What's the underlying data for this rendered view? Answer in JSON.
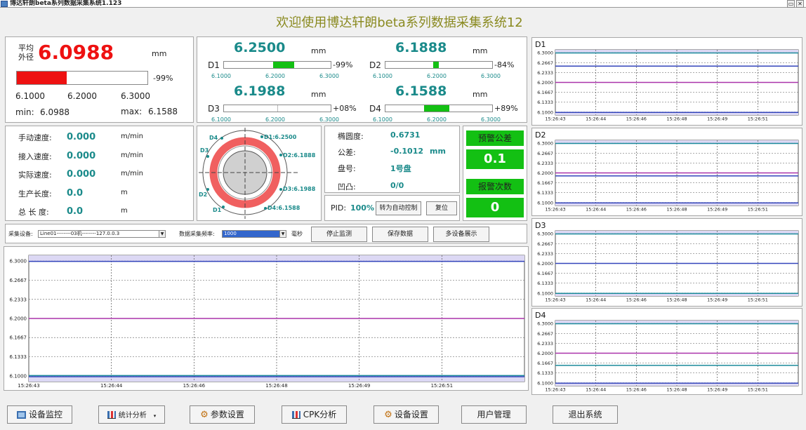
{
  "window": {
    "title": "博达轩朗beta系列数据采集系统1.123"
  },
  "app": {
    "title": "欢迎使用博达轩朗beta系列数据采集系统12"
  },
  "avg": {
    "label1": "平均",
    "label2": "外径",
    "value": "6.0988",
    "unit": "mm",
    "percent": "-99%",
    "fill": 0.38,
    "ticks": [
      "6.1000",
      "6.2000",
      "6.3000"
    ],
    "min_label": "min:",
    "min": "6.0988",
    "max_label": "max:",
    "max": "6.1588"
  },
  "sensors": [
    {
      "name": "D1",
      "value": "6.2500",
      "unit": "mm",
      "percent": "-99%",
      "ticks": [
        "6.1000",
        "6.2000",
        "6.3000"
      ],
      "fill_from": 0.46,
      "fill_to": 0.66
    },
    {
      "name": "D2",
      "value": "6.1888",
      "unit": "mm",
      "percent": "-84%",
      "ticks": [
        "6.1000",
        "6.2000",
        "6.3000"
      ],
      "fill_from": 0.45,
      "fill_to": 0.5
    },
    {
      "name": "D3",
      "value": "6.1988",
      "unit": "mm",
      "percent": "+08%",
      "ticks": [
        "6.1000",
        "6.2000",
        "6.3000"
      ],
      "fill_from": 0.5,
      "fill_to": 0.5
    },
    {
      "name": "D4",
      "value": "6.1588",
      "unit": "mm",
      "percent": "+89%",
      "ticks": [
        "6.1000",
        "6.2000",
        "6.3000"
      ],
      "fill_from": 0.36,
      "fill_to": 0.6
    }
  ],
  "speeds": [
    {
      "label": "手动速度:",
      "value": "0.000",
      "unit": "m/min"
    },
    {
      "label": "接入速度:",
      "value": "0.000",
      "unit": "m/min"
    },
    {
      "label": "实际速度:",
      "value": "0.000",
      "unit": "m/min"
    },
    {
      "label": "生产长度:",
      "value": "0.0",
      "unit": "m"
    },
    {
      "label": "总  长  度:",
      "value": "0.0",
      "unit": "m"
    }
  ],
  "ring": {
    "labels": {
      "d1a": "D1:6.2500",
      "d2a": "D2:6.1888",
      "d3a": "D3:6.1988",
      "d4a": "D4:6.1588",
      "d1": "D1",
      "d2": "D2",
      "d3": "D3",
      "d4": "D4"
    },
    "colors": {
      "ring": "#f06060",
      "inner": "#d0d0d0"
    }
  },
  "stats": {
    "ellipse_label": "椭圆度:",
    "ellipse": "0.6731",
    "tol_label": "公差:",
    "tol": "-0.1012",
    "tol_unit": "mm",
    "disk_label": "盘号:",
    "disk": "1号盘",
    "dent_label": "凹凸:",
    "dent": "0/0"
  },
  "pid": {
    "label": "PID:",
    "value": "100%",
    "auto_btn": "转为自动控制",
    "reset_btn": "复位"
  },
  "alarm": {
    "warn_tol_label": "预警公差",
    "warn_tol": "0.1",
    "alarm_count_label": "报警次数",
    "alarm_count": "0"
  },
  "controls": {
    "device_label": "采集设备:",
    "device": "Line01--------03机--------127.0.0.3",
    "freq_label": "数据采集频率:",
    "freq": "1000",
    "freq_unit": "毫秒",
    "stop_btn": "停止监测",
    "save_btn": "保存数据",
    "multi_btn": "多设备展示"
  },
  "chart_data": [
    {
      "type": "line",
      "x": [
        "15:26:43",
        "15:26:44",
        "15:26:46",
        "15:26:48",
        "15:26:49",
        "15:26:51"
      ],
      "yticks": [
        "6.3000",
        "6.2667",
        "6.2333",
        "6.2000",
        "6.1667",
        "6.1333",
        "6.1000"
      ],
      "ylim": [
        6.09,
        6.31
      ],
      "series": [
        {
          "color": "#3344bb",
          "values": [
            6.2995,
            6.2995,
            6.2995,
            6.2995,
            6.2995,
            6.2995
          ]
        },
        {
          "color": "#aa33aa",
          "values": [
            6.2,
            6.2,
            6.2,
            6.2,
            6.2,
            6.2
          ]
        },
        {
          "color": "#1a8a9a",
          "values": [
            6.1005,
            6.1005,
            6.1005,
            6.1005,
            6.1005,
            6.1005
          ]
        },
        {
          "color": "#3344bb",
          "values": [
            6.0985,
            6.0985,
            6.0985,
            6.0985,
            6.0985,
            6.0985
          ]
        }
      ]
    },
    {
      "type": "line",
      "title": "D1",
      "x": [
        "15:26:43",
        "15:26:44",
        "15:26:46",
        "15:26:48",
        "15:26:49",
        "15:26:51"
      ],
      "yticks": [
        "6.3000",
        "6.2667",
        "6.2333",
        "6.2000",
        "6.1667",
        "6.1333",
        "6.1000"
      ],
      "ylim": [
        6.09,
        6.31
      ],
      "series": [
        {
          "color": "#1a8a9a",
          "values": [
            6.2995,
            6.2995,
            6.2995,
            6.2995,
            6.2995,
            6.2995
          ]
        },
        {
          "color": "#3344bb",
          "values": [
            6.255,
            6.255,
            6.255,
            6.255,
            6.255,
            6.255
          ]
        },
        {
          "color": "#aa33aa",
          "values": [
            6.2,
            6.2,
            6.2,
            6.2,
            6.2,
            6.2
          ]
        },
        {
          "color": "#3344bb",
          "values": [
            6.099,
            6.099,
            6.099,
            6.099,
            6.099,
            6.099
          ]
        }
      ]
    },
    {
      "type": "line",
      "title": "D2",
      "x": [
        "15:26:43",
        "15:26:44",
        "15:26:46",
        "15:26:48",
        "15:26:49",
        "15:26:51"
      ],
      "yticks": [
        "6.3000",
        "6.2667",
        "6.2333",
        "6.2000",
        "6.1667",
        "6.1333",
        "6.1000"
      ],
      "ylim": [
        6.09,
        6.31
      ],
      "series": [
        {
          "color": "#1a8a9a",
          "values": [
            6.2995,
            6.2995,
            6.2995,
            6.2995,
            6.2995,
            6.2995
          ]
        },
        {
          "color": "#aa33aa",
          "values": [
            6.2,
            6.2,
            6.2,
            6.2,
            6.2,
            6.2
          ]
        },
        {
          "color": "#3344bb",
          "values": [
            6.19,
            6.19,
            6.19,
            6.19,
            6.19,
            6.19
          ]
        },
        {
          "color": "#3344bb",
          "values": [
            6.099,
            6.099,
            6.099,
            6.099,
            6.099,
            6.099
          ]
        }
      ]
    },
    {
      "type": "line",
      "title": "D3",
      "x": [
        "15:26:43",
        "15:26:44",
        "15:26:46",
        "15:26:48",
        "15:26:49",
        "15:26:51"
      ],
      "yticks": [
        "6.3000",
        "6.2667",
        "6.2333",
        "6.2000",
        "6.1667",
        "6.1333",
        "6.1000"
      ],
      "ylim": [
        6.09,
        6.31
      ],
      "series": [
        {
          "color": "#1a8a9a",
          "values": [
            6.2995,
            6.2995,
            6.2995,
            6.2995,
            6.2995,
            6.2995
          ]
        },
        {
          "color": "#3344bb",
          "values": [
            6.2,
            6.2,
            6.2,
            6.2,
            6.2,
            6.2
          ]
        },
        {
          "color": "#1a8a9a",
          "values": [
            6.099,
            6.099,
            6.099,
            6.099,
            6.099,
            6.099
          ]
        }
      ]
    },
    {
      "type": "line",
      "title": "D4",
      "x": [
        "15:26:43",
        "15:26:44",
        "15:26:46",
        "15:26:48",
        "15:26:49",
        "15:26:51"
      ],
      "yticks": [
        "6.3000",
        "6.2667",
        "6.2333",
        "6.2000",
        "6.1667",
        "6.1333",
        "6.1000"
      ],
      "ylim": [
        6.09,
        6.31
      ],
      "series": [
        {
          "color": "#1a8a9a",
          "values": [
            6.2995,
            6.2995,
            6.2995,
            6.2995,
            6.2995,
            6.2995
          ]
        },
        {
          "color": "#aa33aa",
          "values": [
            6.2,
            6.2,
            6.2,
            6.2,
            6.2,
            6.2
          ]
        },
        {
          "color": "#1a8a9a",
          "values": [
            6.159,
            6.159,
            6.159,
            6.159,
            6.159,
            6.159
          ]
        },
        {
          "color": "#3344bb",
          "values": [
            6.099,
            6.099,
            6.099,
            6.099,
            6.099,
            6.099
          ]
        }
      ]
    }
  ],
  "nav": [
    {
      "label": "设备监控",
      "icon": "monitor-icon"
    },
    {
      "label": "统计分析",
      "icon": "bar-chart-icon"
    },
    {
      "label": "参数设置",
      "icon": "gear-icon"
    },
    {
      "label": "CPK分析",
      "icon": "bar-chart-icon"
    },
    {
      "label": "设备设置",
      "icon": "gear-icon"
    },
    {
      "label": "用户管理",
      "icon": ""
    },
    {
      "label": "退出系统",
      "icon": ""
    }
  ],
  "colors": {
    "red": "#ee1111",
    "green": "#13c013",
    "teal": "#1a8a8a",
    "plot_band": "#dcd8f4"
  }
}
